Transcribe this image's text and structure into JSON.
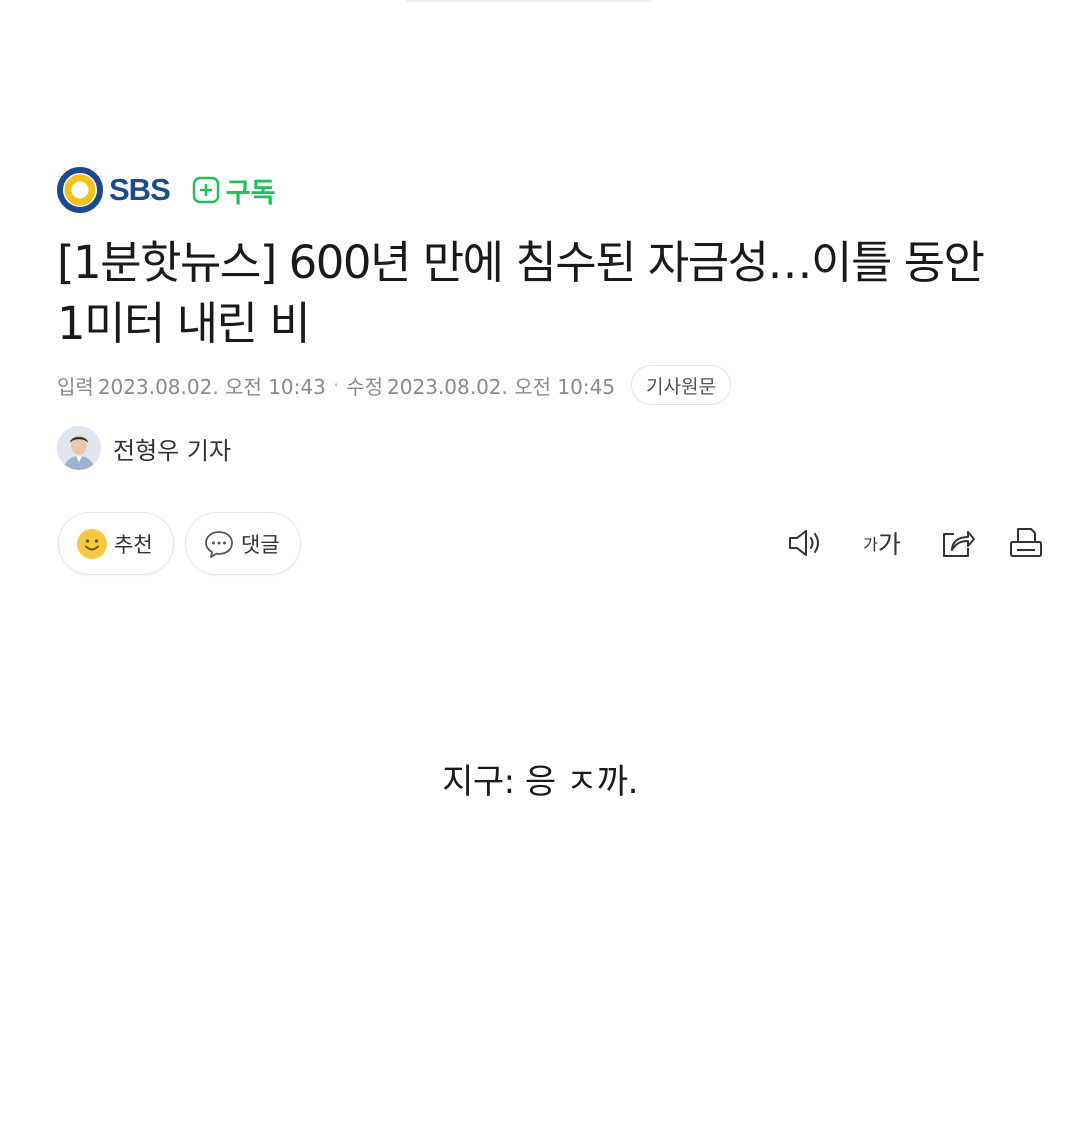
{
  "press": {
    "name": "SBS",
    "brand_color": "#1c4a8f",
    "ring_color": "#f2c21b",
    "subscribe_label": "구독",
    "subscribe_color": "#1fbf5a"
  },
  "article": {
    "title": "[1분핫뉴스] 600년 만에 침수된 자금성…이틀 동안 1미터 내린 비",
    "input_label": "입력",
    "input_datetime": "2023.08.02. 오전 10:43",
    "modified_label": "수정",
    "modified_datetime": "2023.08.02. 오전 10:45",
    "original_button": "기사원문"
  },
  "reporter": {
    "name": "전형우 기자"
  },
  "actions": {
    "recommend_label": "추천",
    "comment_label": "댓글"
  },
  "tools": {
    "audio_icon": "speaker-icon",
    "font_small": "가",
    "font_large": "가",
    "share_icon": "share-icon",
    "print_icon": "print-icon"
  },
  "caption": "지구: 응 ㅈ까."
}
